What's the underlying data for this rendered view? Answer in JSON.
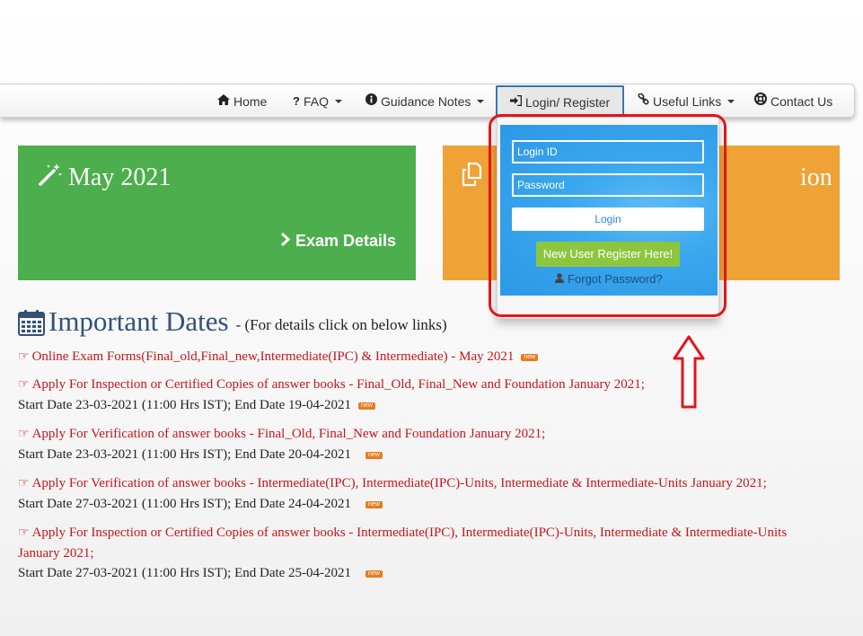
{
  "nav": {
    "items": [
      {
        "icon": "home-icon",
        "label": "Home",
        "caret": false
      },
      {
        "icon": "question-icon",
        "label": "FAQ",
        "caret": true
      },
      {
        "icon": "info-circle-icon",
        "label": "Guidance Notes",
        "caret": true
      },
      {
        "icon": "sign-in-icon",
        "label": "Login/ Register",
        "caret": false,
        "active": true
      },
      {
        "icon": "link-icon",
        "label": "Useful Links",
        "caret": true
      },
      {
        "icon": "lifebuoy-icon",
        "label": "Contact Us",
        "caret": false
      }
    ],
    "active_border_color": "#3a74b0"
  },
  "tiles": {
    "green": {
      "title": "May 2021",
      "link": "Exam Details",
      "color": "#4cae4c"
    },
    "orange": {
      "title_left": "",
      "title_right": "ion",
      "color": "#efa235"
    }
  },
  "login": {
    "login_id_placeholder": "Login ID",
    "password_placeholder": "Password",
    "login_button": "Login",
    "register_button": "New User Register Here!",
    "forgot_password": "Forgot Password?",
    "panel_color": "#3aa7ee",
    "register_color": "#8cc63e"
  },
  "annotation": {
    "highlight_color": "#e3151d"
  },
  "dates": {
    "heading": "Important Dates",
    "subheading": "- (For details click on below links)",
    "badge_text": "new",
    "notices": [
      {
        "link": "Online Exam Forms(Final_old,Final_new,Intermediate(IPC) & Intermediate) - May 2021",
        "dates": ""
      },
      {
        "link": "Apply For Inspection or Certified Copies of answer books - Final_Old, Final_New and Foundation January 2021;",
        "dates": "Start Date 23-03-2021 (11:00 Hrs IST); End Date 19-04-2021"
      },
      {
        "link": "Apply For Verification of answer books - Final_Old, Final_New and Foundation January 2021;",
        "dates": "Start Date 23-03-2021 (11:00 Hrs IST); End Date 20-04-2021"
      },
      {
        "link": "Apply For Verification of answer books - Intermediate(IPC), Intermediate(IPC)-Units, Intermediate & Intermediate-Units January 2021;",
        "dates": "Start Date 27-03-2021 (11:00 Hrs IST); End Date 24-04-2021"
      },
      {
        "link": "Apply For Inspection or Certified Copies of answer books - Intermediate(IPC), Intermediate(IPC)-Units, Intermediate & Intermediate-Units January 2021;",
        "dates": "Start Date 27-03-2021 (11:00 Hrs IST); End Date 25-04-2021"
      }
    ]
  }
}
